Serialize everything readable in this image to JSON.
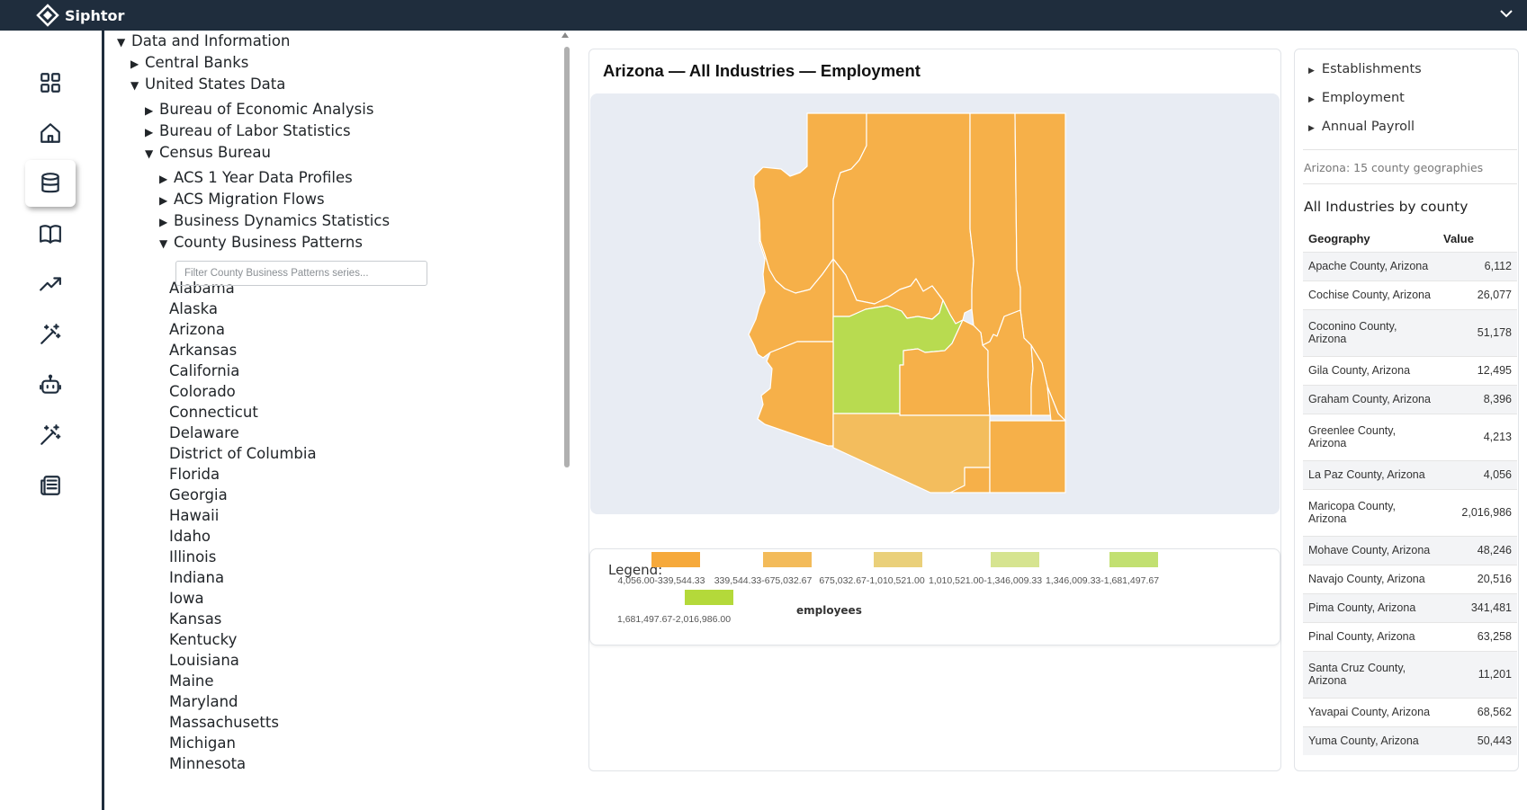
{
  "app": {
    "name": "Siphtor"
  },
  "nav": {
    "items": [
      "dashboard-icon",
      "home-icon",
      "database-icon",
      "book-icon",
      "trending-icon",
      "magic-wand-icon",
      "robot-icon",
      "magic-wand-icon",
      "news-icon"
    ],
    "active_index": 2
  },
  "tree": {
    "root": "Data and Information",
    "central_banks": "Central Banks",
    "us_data": "United States Data",
    "bea": "Bureau of Economic Analysis",
    "bls": "Bureau of Labor Statistics",
    "census": "Census Bureau",
    "acs1": "ACS 1 Year Data Profiles",
    "acs_mig": "ACS Migration Flows",
    "bds": "Business Dynamics Statistics",
    "cbp": "County Business Patterns",
    "filter_placeholder": "Filter County Business Patterns series...",
    "states": [
      "Alabama",
      "Alaska",
      "Arizona",
      "Arkansas",
      "California",
      "Colorado",
      "Connecticut",
      "Delaware",
      "District of Columbia",
      "Florida",
      "Georgia",
      "Hawaii",
      "Idaho",
      "Illinois",
      "Indiana",
      "Iowa",
      "Kansas",
      "Kentucky",
      "Louisiana",
      "Maine",
      "Maryland",
      "Massachusetts",
      "Michigan",
      "Minnesota"
    ]
  },
  "main": {
    "title": "Arizona — All Industries — Employment"
  },
  "legend": {
    "label": "Legend:",
    "units": "employees",
    "bins": [
      {
        "range": "4,056.00-339,544.33",
        "color": "#f6a93b"
      },
      {
        "range": "339,544.33-675,032.67",
        "color": "#f3bb5a"
      },
      {
        "range": "675,032.67-1,010,521.00",
        "color": "#ead07a"
      },
      {
        "range": "1,010,521.00-1,346,009.33",
        "color": "#d6e490"
      },
      {
        "range": "1,346,009.33-1,681,497.67",
        "color": "#c2e071"
      },
      {
        "range": "1,681,497.67-2,016,986.00",
        "color": "#b4d93a"
      }
    ]
  },
  "side": {
    "links": [
      "Establishments",
      "Employment",
      "Annual Payroll"
    ],
    "note": "Arizona: 15 county geographies",
    "heading": "All Industries by county",
    "col_geo": "Geography",
    "col_val": "Value",
    "rows": [
      {
        "geo": "Apache County, Arizona",
        "value": "6,112"
      },
      {
        "geo": "Cochise County, Arizona",
        "value": "26,077"
      },
      {
        "geo": "Coconino County, Arizona",
        "value": "51,178"
      },
      {
        "geo": "Gila County, Arizona",
        "value": "12,495"
      },
      {
        "geo": "Graham County, Arizona",
        "value": "8,396"
      },
      {
        "geo": "Greenlee County, Arizona",
        "value": "4,213"
      },
      {
        "geo": "La Paz County, Arizona",
        "value": "4,056"
      },
      {
        "geo": "Maricopa County, Arizona",
        "value": "2,016,986"
      },
      {
        "geo": "Mohave County, Arizona",
        "value": "48,246"
      },
      {
        "geo": "Navajo County, Arizona",
        "value": "20,516"
      },
      {
        "geo": "Pima County, Arizona",
        "value": "341,481"
      },
      {
        "geo": "Pinal County, Arizona",
        "value": "63,258"
      },
      {
        "geo": "Santa Cruz County, Arizona",
        "value": "11,201"
      },
      {
        "geo": "Yavapai County, Arizona",
        "value": "68,562"
      },
      {
        "geo": "Yuma County, Arizona",
        "value": "50,443"
      }
    ]
  }
}
